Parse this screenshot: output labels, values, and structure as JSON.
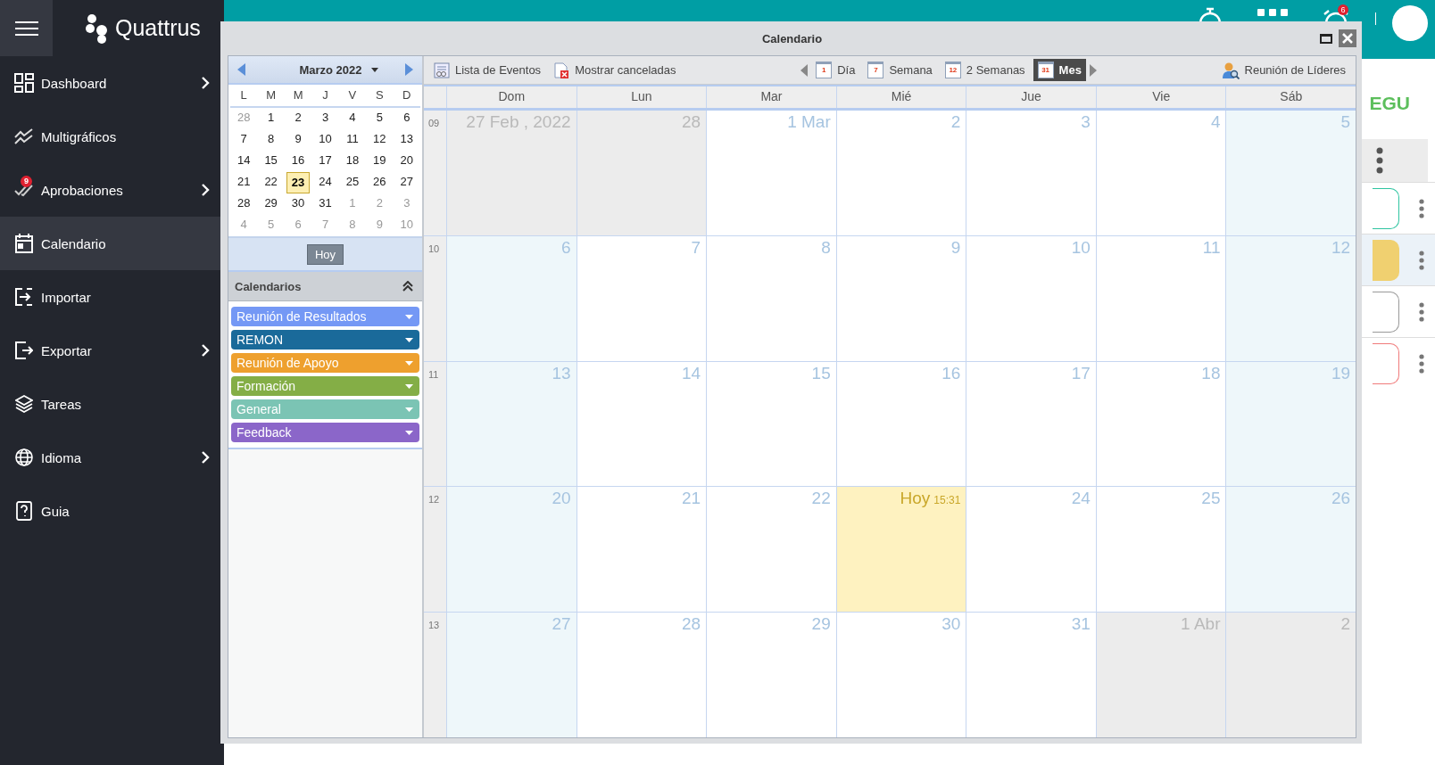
{
  "brand": {
    "name": "Quattrus"
  },
  "sidebar": {
    "items": [
      {
        "label": "Dashboard",
        "has_submenu": true,
        "selected": false
      },
      {
        "label": "Multigráficos",
        "has_submenu": false,
        "selected": false
      },
      {
        "label": "Aprobaciones",
        "has_submenu": true,
        "selected": false,
        "badge": "9"
      },
      {
        "label": "Calendario",
        "has_submenu": false,
        "selected": true
      },
      {
        "label": "Importar",
        "has_submenu": false,
        "selected": false
      },
      {
        "label": "Exportar",
        "has_submenu": true,
        "selected": false
      },
      {
        "label": "Tareas",
        "has_submenu": false,
        "selected": false
      },
      {
        "label": "Idioma",
        "has_submenu": true,
        "selected": false
      },
      {
        "label": "Guia",
        "has_submenu": false,
        "selected": false
      }
    ]
  },
  "header": {
    "alarm_badge": "6"
  },
  "background_page": {
    "heading": "EGU",
    "cards": [
      {
        "color": "#2ec4a0"
      },
      {
        "color": "#f0d070"
      },
      {
        "color": "#999999"
      },
      {
        "color": "#f07a7a"
      }
    ]
  },
  "window": {
    "title": "Calendario"
  },
  "mini_calendar": {
    "month": "Marzo 2022",
    "weekdays": [
      "L",
      "M",
      "M",
      "J",
      "V",
      "S",
      "D"
    ],
    "weeks": [
      [
        {
          "d": "28",
          "kind": "other"
        },
        {
          "d": "1",
          "kind": "current"
        },
        {
          "d": "2",
          "kind": "current"
        },
        {
          "d": "3",
          "kind": "current"
        },
        {
          "d": "4",
          "kind": "current"
        },
        {
          "d": "5",
          "kind": "current"
        },
        {
          "d": "6",
          "kind": "current"
        }
      ],
      [
        {
          "d": "7",
          "kind": "current"
        },
        {
          "d": "8",
          "kind": "current"
        },
        {
          "d": "9",
          "kind": "current"
        },
        {
          "d": "10",
          "kind": "current"
        },
        {
          "d": "11",
          "kind": "current"
        },
        {
          "d": "12",
          "kind": "current"
        },
        {
          "d": "13",
          "kind": "current"
        }
      ],
      [
        {
          "d": "14",
          "kind": "current"
        },
        {
          "d": "15",
          "kind": "current"
        },
        {
          "d": "16",
          "kind": "current"
        },
        {
          "d": "17",
          "kind": "current"
        },
        {
          "d": "18",
          "kind": "current"
        },
        {
          "d": "19",
          "kind": "current"
        },
        {
          "d": "20",
          "kind": "current"
        }
      ],
      [
        {
          "d": "21",
          "kind": "current"
        },
        {
          "d": "22",
          "kind": "current"
        },
        {
          "d": "23",
          "kind": "today"
        },
        {
          "d": "24",
          "kind": "current"
        },
        {
          "d": "25",
          "kind": "current"
        },
        {
          "d": "26",
          "kind": "current"
        },
        {
          "d": "27",
          "kind": "current"
        }
      ],
      [
        {
          "d": "28",
          "kind": "current"
        },
        {
          "d": "29",
          "kind": "current"
        },
        {
          "d": "30",
          "kind": "current"
        },
        {
          "d": "31",
          "kind": "current"
        },
        {
          "d": "1",
          "kind": "other"
        },
        {
          "d": "2",
          "kind": "other"
        },
        {
          "d": "3",
          "kind": "other"
        }
      ],
      [
        {
          "d": "4",
          "kind": "other"
        },
        {
          "d": "5",
          "kind": "other"
        },
        {
          "d": "6",
          "kind": "other"
        },
        {
          "d": "7",
          "kind": "other"
        },
        {
          "d": "8",
          "kind": "other"
        },
        {
          "d": "9",
          "kind": "other"
        },
        {
          "d": "10",
          "kind": "other"
        }
      ]
    ],
    "today_button": "Hoy"
  },
  "calendars": {
    "title": "Calendarios",
    "expanded": true,
    "items": [
      {
        "label": "Reunión de Resultados",
        "color": "#7498f5"
      },
      {
        "label": "REMON",
        "color": "#1a6a9a"
      },
      {
        "label": "Reunión de Apoyo",
        "color": "#eea02e"
      },
      {
        "label": "Formación",
        "color": "#84ae46"
      },
      {
        "label": "General",
        "color": "#7bc4b4"
      },
      {
        "label": "Feedback",
        "color": "#8b66c9"
      }
    ]
  },
  "toolbar": {
    "left": [
      {
        "label": "Lista de Eventos"
      },
      {
        "label": "Mostrar canceladas"
      }
    ],
    "views": [
      {
        "label": "Día",
        "num": "1",
        "selected": false
      },
      {
        "label": "Semana",
        "num": "7",
        "selected": false
      },
      {
        "label": "2 Semanas",
        "num": "12",
        "selected": false
      },
      {
        "label": "Mes",
        "num": "31",
        "selected": true
      }
    ],
    "right": {
      "label": "Reunión de Líderes"
    }
  },
  "month_view": {
    "weekdays": [
      "Dom",
      "Lun",
      "Mar",
      "Mié",
      "Jue",
      "Vie",
      "Sáb"
    ],
    "weeks": [
      {
        "week": "09",
        "days": [
          {
            "label": "27 Feb , 2022",
            "kind": "other"
          },
          {
            "label": "28",
            "kind": "other"
          },
          {
            "label": "1 Mar",
            "kind": "weekday"
          },
          {
            "label": "2",
            "kind": "weekday"
          },
          {
            "label": "3",
            "kind": "weekday"
          },
          {
            "label": "4",
            "kind": "weekday"
          },
          {
            "label": "5",
            "kind": "weekend"
          }
        ]
      },
      {
        "week": "10",
        "days": [
          {
            "label": "6",
            "kind": "weekend"
          },
          {
            "label": "7",
            "kind": "weekday"
          },
          {
            "label": "8",
            "kind": "weekday"
          },
          {
            "label": "9",
            "kind": "weekday"
          },
          {
            "label": "10",
            "kind": "weekday"
          },
          {
            "label": "11",
            "kind": "weekday"
          },
          {
            "label": "12",
            "kind": "weekend"
          }
        ]
      },
      {
        "week": "11",
        "days": [
          {
            "label": "13",
            "kind": "weekend"
          },
          {
            "label": "14",
            "kind": "weekday"
          },
          {
            "label": "15",
            "kind": "weekday"
          },
          {
            "label": "16",
            "kind": "weekday"
          },
          {
            "label": "17",
            "kind": "weekday"
          },
          {
            "label": "18",
            "kind": "weekday"
          },
          {
            "label": "19",
            "kind": "weekend"
          }
        ]
      },
      {
        "week": "12",
        "days": [
          {
            "label": "20",
            "kind": "weekend"
          },
          {
            "label": "21",
            "kind": "weekday"
          },
          {
            "label": "22",
            "kind": "weekday"
          },
          {
            "label": "Hoy",
            "time": "15:31",
            "kind": "today"
          },
          {
            "label": "24",
            "kind": "weekday"
          },
          {
            "label": "25",
            "kind": "weekday"
          },
          {
            "label": "26",
            "kind": "weekend"
          }
        ]
      },
      {
        "week": "13",
        "days": [
          {
            "label": "27",
            "kind": "weekend"
          },
          {
            "label": "28",
            "kind": "weekday"
          },
          {
            "label": "29",
            "kind": "weekday"
          },
          {
            "label": "30",
            "kind": "weekday"
          },
          {
            "label": "31",
            "kind": "weekday"
          },
          {
            "label": "1 Abr",
            "kind": "other"
          },
          {
            "label": "2",
            "kind": "other"
          }
        ]
      }
    ]
  }
}
